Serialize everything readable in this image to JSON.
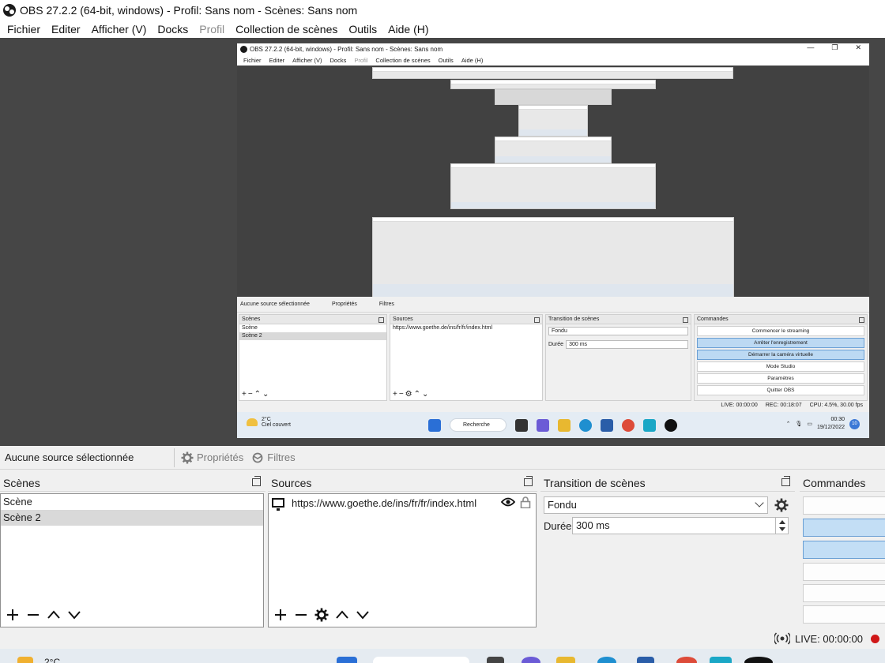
{
  "window": {
    "title": "OBS 27.2.2 (64-bit, windows) - Profil: Sans nom - Scènes: Sans nom"
  },
  "menu": [
    {
      "label": "Fichier",
      "disabled": false
    },
    {
      "label": "Editer",
      "disabled": false
    },
    {
      "label": "Afficher (V)",
      "disabled": false
    },
    {
      "label": "Docks",
      "disabled": false
    },
    {
      "label": "Profil",
      "disabled": true
    },
    {
      "label": "Collection de scènes",
      "disabled": false
    },
    {
      "label": "Outils",
      "disabled": false
    },
    {
      "label": "Aide (H)",
      "disabled": false
    }
  ],
  "preview": {
    "nested": {
      "title": "OBS 27.2.2 (64-bit, windows) - Profil: Sans nom - Scènes: Sans nom",
      "controls": [
        "—",
        "❐",
        "✕"
      ],
      "menu": [
        "Fichier",
        "Editer",
        "Afficher (V)",
        "Docks",
        "Profil",
        "Collection de scènes",
        "Outils",
        "Aide (H)"
      ],
      "no_source": "Aucune source sélectionnée",
      "properties": "Propriétés",
      "filters": "Filtres",
      "scenes_title": "Scènes",
      "scenes": [
        "Scène",
        "Scène 2"
      ],
      "sources_title": "Sources",
      "source_url": "https://www.goethe.de/ins/fr/fr/index.html",
      "transition_title": "Transition de scènes",
      "transition_value": "Fondu",
      "duration_label": "Durée",
      "duration_value": "300 ms",
      "commands_title": "Commandes",
      "commands": [
        {
          "label": "Commencer le streaming",
          "active": false
        },
        {
          "label": "Arrêter l'enregistrement",
          "active": true
        },
        {
          "label": "Démarrer la caméra virtuelle",
          "active": true
        },
        {
          "label": "Mode Studio",
          "active": false
        },
        {
          "label": "Paramètres",
          "active": false
        },
        {
          "label": "Quitter OBS",
          "active": false
        }
      ],
      "status": {
        "live": "LIVE: 00:00:00",
        "rec": "REC: 00:18:07",
        "cpu": "CPU: 4.5%, 30.00 fps"
      },
      "taskbar": {
        "temp": "2°C",
        "weather": "Ciel couvert",
        "search": "Recherche",
        "time": "00:30",
        "date": "19/12/2022",
        "badge": "10"
      }
    }
  },
  "toolbar": {
    "no_source": "Aucune source sélectionnée",
    "properties": "Propriétés",
    "filters": "Filtres"
  },
  "scenes": {
    "title": "Scènes",
    "items": [
      "Scène",
      "Scène 2"
    ],
    "selected_index": 1
  },
  "sources": {
    "title": "Sources",
    "items": [
      {
        "label": "https://www.goethe.de/ins/fr/fr/index.html",
        "visible": true,
        "locked": false
      }
    ]
  },
  "transition": {
    "title": "Transition de scènes",
    "value": "Fondu",
    "duration_label": "Durée",
    "duration_value": "300 ms"
  },
  "commands": {
    "title": "Commandes",
    "buttons": [
      {
        "active": false
      },
      {
        "active": true
      },
      {
        "active": true
      },
      {
        "active": false
      },
      {
        "active": false
      },
      {
        "active": false
      }
    ]
  },
  "status": {
    "live": "LIVE: 00:00:00"
  },
  "taskbar": {
    "temp": "2°C"
  },
  "colors": {
    "preview_bg": "#464646",
    "active_button": "#c3def5",
    "rec_dot": "#d01818"
  }
}
